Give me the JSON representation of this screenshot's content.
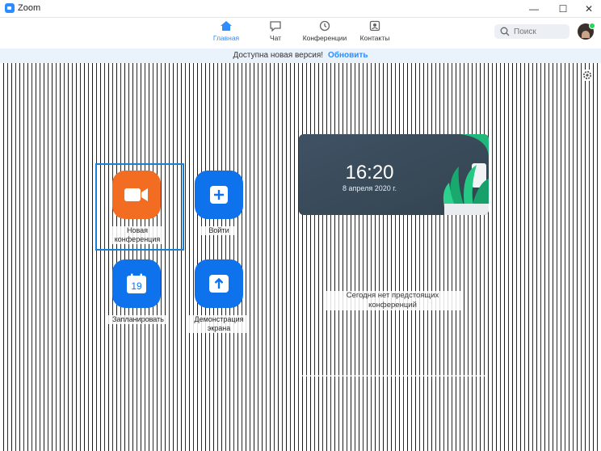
{
  "window": {
    "title": "Zoom",
    "minimize": "—",
    "maximize": "☐",
    "close": "✕"
  },
  "nav": {
    "items": [
      {
        "label": "Главная",
        "icon": "home-icon",
        "active": true
      },
      {
        "label": "Чат",
        "icon": "chat-icon",
        "active": false
      },
      {
        "label": "Конференции",
        "icon": "clock-icon",
        "active": false
      },
      {
        "label": "Контакты",
        "icon": "contacts-icon",
        "active": false
      }
    ],
    "search_placeholder": "Поиск"
  },
  "banner": {
    "text": "Доступна новая версия!",
    "link": "Обновить"
  },
  "actions": [
    {
      "label_line1": "Новая",
      "label_line2": "конференция",
      "icon": "video-camera-icon",
      "color": "#f26d21"
    },
    {
      "label_line1": "Войти",
      "label_line2": "",
      "icon": "plus-icon",
      "color": "#0e72ed"
    },
    {
      "label_line1": "Запланировать",
      "label_line2": "",
      "icon": "calendar-icon",
      "color": "#0e72ed",
      "calendar_day": "19"
    },
    {
      "label_line1": "Демонстрация",
      "label_line2": "экрана",
      "icon": "share-screen-icon",
      "color": "#0e72ed"
    }
  ],
  "clock": {
    "time": "16:20",
    "date": "8 апреля 2020 г."
  },
  "upcoming": {
    "empty_text": "Сегодня нет предстоящих конференций"
  },
  "colors": {
    "accent": "#2d8cff",
    "orange": "#f26d21",
    "blue": "#0e72ed",
    "banner_bg": "#eaf2fb"
  }
}
